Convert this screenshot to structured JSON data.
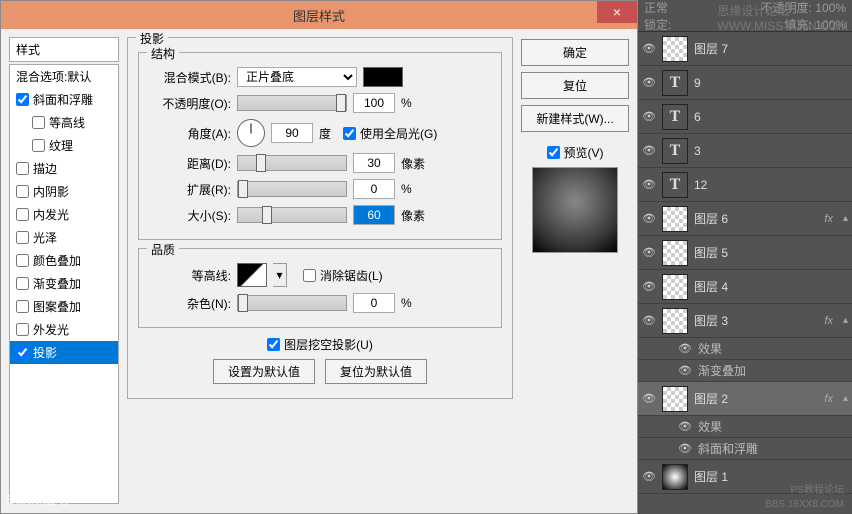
{
  "dialog": {
    "title": "图层样式",
    "close": "×",
    "styles_header": "样式",
    "styles": [
      {
        "label": "混合选项:默认",
        "checked": null,
        "sub": false
      },
      {
        "label": "斜面和浮雕",
        "checked": true,
        "sub": false
      },
      {
        "label": "等高线",
        "checked": false,
        "sub": true
      },
      {
        "label": "纹理",
        "checked": false,
        "sub": true
      },
      {
        "label": "描边",
        "checked": false,
        "sub": false
      },
      {
        "label": "内阴影",
        "checked": false,
        "sub": false
      },
      {
        "label": "内发光",
        "checked": false,
        "sub": false
      },
      {
        "label": "光泽",
        "checked": false,
        "sub": false
      },
      {
        "label": "颜色叠加",
        "checked": false,
        "sub": false
      },
      {
        "label": "渐变叠加",
        "checked": false,
        "sub": false
      },
      {
        "label": "图案叠加",
        "checked": false,
        "sub": false
      },
      {
        "label": "外发光",
        "checked": false,
        "sub": false
      },
      {
        "label": "投影",
        "checked": true,
        "sub": false,
        "selected": true
      }
    ],
    "section_shadow": "投影",
    "section_struct": "结构",
    "blend_mode_label": "混合模式(B):",
    "blend_mode_value": "正片叠底",
    "opacity_label": "不透明度(O):",
    "opacity_value": "100",
    "pct": "%",
    "angle_label": "角度(A):",
    "angle_value": "90",
    "angle_unit": "度",
    "global_light": "使用全局光(G)",
    "distance_label": "距离(D):",
    "distance_value": "30",
    "px": "像素",
    "spread_label": "扩展(R):",
    "spread_value": "0",
    "size_label": "大小(S):",
    "size_value": "60",
    "section_quality": "品质",
    "contour_label": "等高线:",
    "antialias": "消除锯齿(L)",
    "noise_label": "杂色(N):",
    "noise_value": "0",
    "knockout": "图层挖空投影(U)",
    "reset_default": "设置为默认值",
    "restore_default": "复位为默认值",
    "btn_ok": "确定",
    "btn_cancel": "复位",
    "btn_newstyle": "新建样式(W)...",
    "preview": "预览(V)"
  },
  "panel": {
    "watermark_top": "思缘设计论坛",
    "watermark_url": "WWW.MISSYUAN.COM",
    "top1_l": "正常",
    "top1_r": "不透明度: 100%",
    "top2_l": "锁定:",
    "top2_r": "填充: 100%",
    "layers": [
      {
        "type": "img",
        "name": "图层 7"
      },
      {
        "type": "text",
        "name": "9"
      },
      {
        "type": "text",
        "name": "6"
      },
      {
        "type": "text",
        "name": "3"
      },
      {
        "type": "text",
        "name": "12"
      },
      {
        "type": "img",
        "name": "图层 6",
        "fx": true
      },
      {
        "type": "img",
        "name": "图层 5"
      },
      {
        "type": "img",
        "name": "图层 4"
      },
      {
        "type": "img",
        "name": "图层 3",
        "fx": true,
        "effects": [
          "效果",
          "渐变叠加"
        ]
      },
      {
        "type": "img",
        "name": "图层 2",
        "fx": true,
        "selected": true,
        "effects": [
          "效果",
          "斜面和浮雕"
        ]
      },
      {
        "type": "glow",
        "name": "图层 1"
      }
    ],
    "wm1": "PS教程论坛",
    "wm2": "BBS.16XX8.COM",
    "baidu": "Baidu贴吧"
  }
}
